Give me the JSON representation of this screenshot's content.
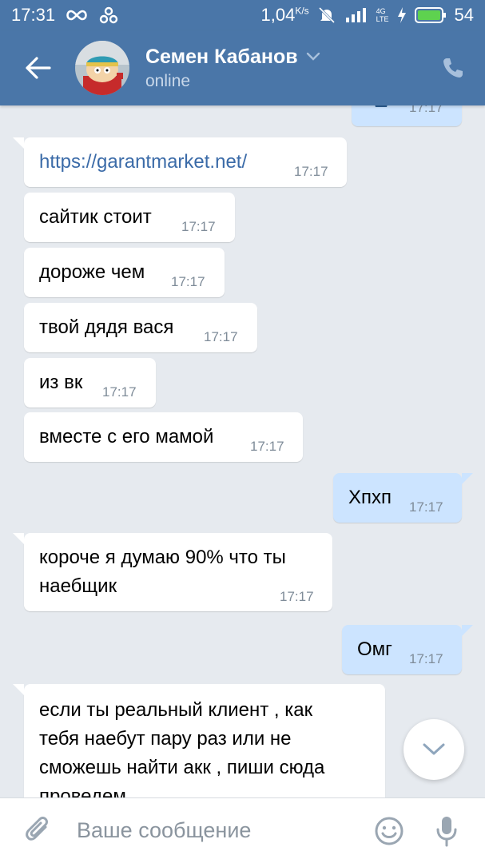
{
  "status_bar": {
    "time": "17:31",
    "speed": "1,04",
    "speed_unit": "K/s",
    "network": "4G",
    "network_sub": "LTE",
    "battery": "54"
  },
  "header": {
    "name": "Семен Кабанов",
    "status": "online"
  },
  "messages": [
    {
      "side": "out",
      "text": "",
      "time": "17:17"
    },
    {
      "side": "in",
      "text": "https://garantmarket.net/",
      "time": "17:17",
      "is_link": true
    },
    {
      "side": "in",
      "text": "сайтик стоит",
      "time": "17:17"
    },
    {
      "side": "in",
      "text": "дороже чем",
      "time": "17:17"
    },
    {
      "side": "in",
      "text": "твой дядя вася",
      "time": "17:17"
    },
    {
      "side": "in",
      "text": "из вк",
      "time": "17:17"
    },
    {
      "side": "in",
      "text": "вместе с его мамой",
      "time": "17:17"
    },
    {
      "side": "out",
      "text": "Хпхп",
      "time": "17:17"
    },
    {
      "side": "in",
      "text_lines": [
        "короче я думаю 90% что ты",
        "наебщик"
      ],
      "time": "17:17"
    },
    {
      "side": "out",
      "text": "Омг",
      "time": "17:17"
    },
    {
      "side": "in",
      "text_lines": [
        "если ты реальный клиент , как",
        "тебя наебут пару раз или не",
        "сможешь найти акк , пиши сюда",
        "проведем"
      ]
    }
  ],
  "composer": {
    "placeholder": "Ваше сообщение"
  },
  "colors": {
    "header_bg": "#4a76a8",
    "chat_bg": "#e6eaef",
    "bubble_in": "#ffffff",
    "bubble_out": "#cce4ff",
    "link": "#3b6ba8"
  }
}
